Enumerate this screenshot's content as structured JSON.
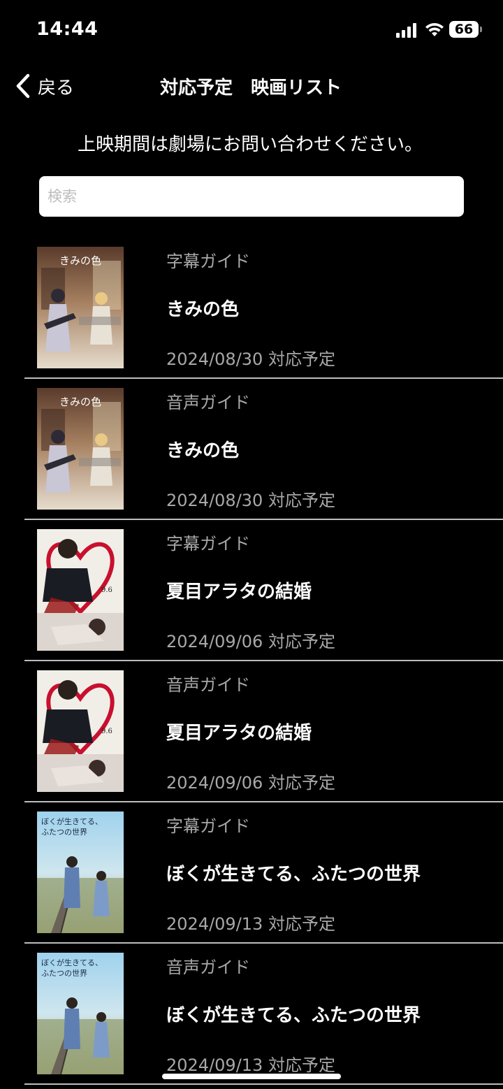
{
  "status_bar": {
    "time": "14:44",
    "battery": "66"
  },
  "nav": {
    "back_label": "戻る",
    "title": "対応予定　映画リスト"
  },
  "notice": "上映期間は劇場にお問い合わせください。",
  "search": {
    "placeholder": "検索",
    "value": ""
  },
  "movies": [
    {
      "guide": "字幕ガイド",
      "title": "きみの色",
      "date": "2024/08/30 対応予定",
      "poster": "kimi-no-iro"
    },
    {
      "guide": "音声ガイド",
      "title": "きみの色",
      "date": "2024/08/30 対応予定",
      "poster": "kimi-no-iro"
    },
    {
      "guide": "字幕ガイド",
      "title": "夏目アラタの結婚",
      "date": "2024/09/06 対応予定",
      "poster": "natsume-arata"
    },
    {
      "guide": "音声ガイド",
      "title": "夏目アラタの結婚",
      "date": "2024/09/06 対応予定",
      "poster": "natsume-arata"
    },
    {
      "guide": "字幕ガイド",
      "title": "ぼくが生きてる、ふたつの世界",
      "date": "2024/09/13 対応予定",
      "poster": "bokuga-ikiteru"
    },
    {
      "guide": "音声ガイド",
      "title": "ぼくが生きてる、ふたつの世界",
      "date": "2024/09/13 対応予定",
      "poster": "bokuga-ikiteru"
    }
  ],
  "colors": {
    "background": "#000000",
    "text_primary": "#ffffff",
    "text_secondary": "#a8a8a8",
    "divider": "#bdbdbd"
  }
}
